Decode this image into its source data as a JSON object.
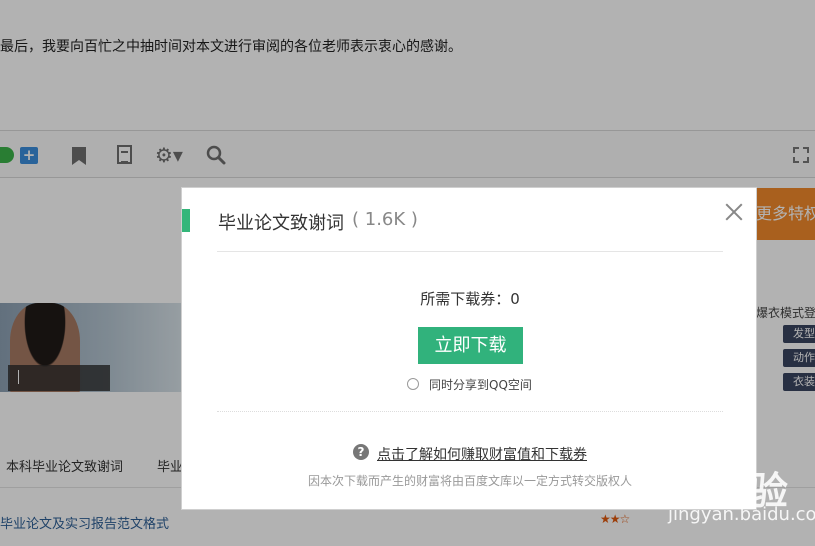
{
  "background": {
    "paragraph_text": "最后，我要向百忙之中抽时间对本文进行审阅的各位老师表示衷心的感谢。",
    "orange_button_label": "更多特权",
    "right_panel": {
      "title": "爆衣模式登",
      "buttons": [
        "发型",
        "动作",
        "衣装"
      ]
    },
    "related_items": [
      "本科毕业论文致谢词",
      "毕业"
    ],
    "bottom_link": "毕业论文及实习报告范文格式",
    "rating_stars": "★★☆"
  },
  "toolbar": {
    "plus_label": "+",
    "gear_label": "⚙▾"
  },
  "modal": {
    "title": "毕业论文致谢词",
    "file_size": "( 1.6K )",
    "cost_text": "所需下载券：0",
    "download_button_label": "立即下载",
    "share_label": "同时分享到QQ空间",
    "help_icon_label": "?",
    "help_link_text": "点击了解如何赚取财富值和下载券",
    "note_text": "因本次下载而产生的财富将由百度文库以一定方式转交版权人",
    "accent_color": "#34b67a"
  },
  "watermark": {
    "logo": "Bai 经验",
    "url": "jingyan.baidu.com"
  }
}
